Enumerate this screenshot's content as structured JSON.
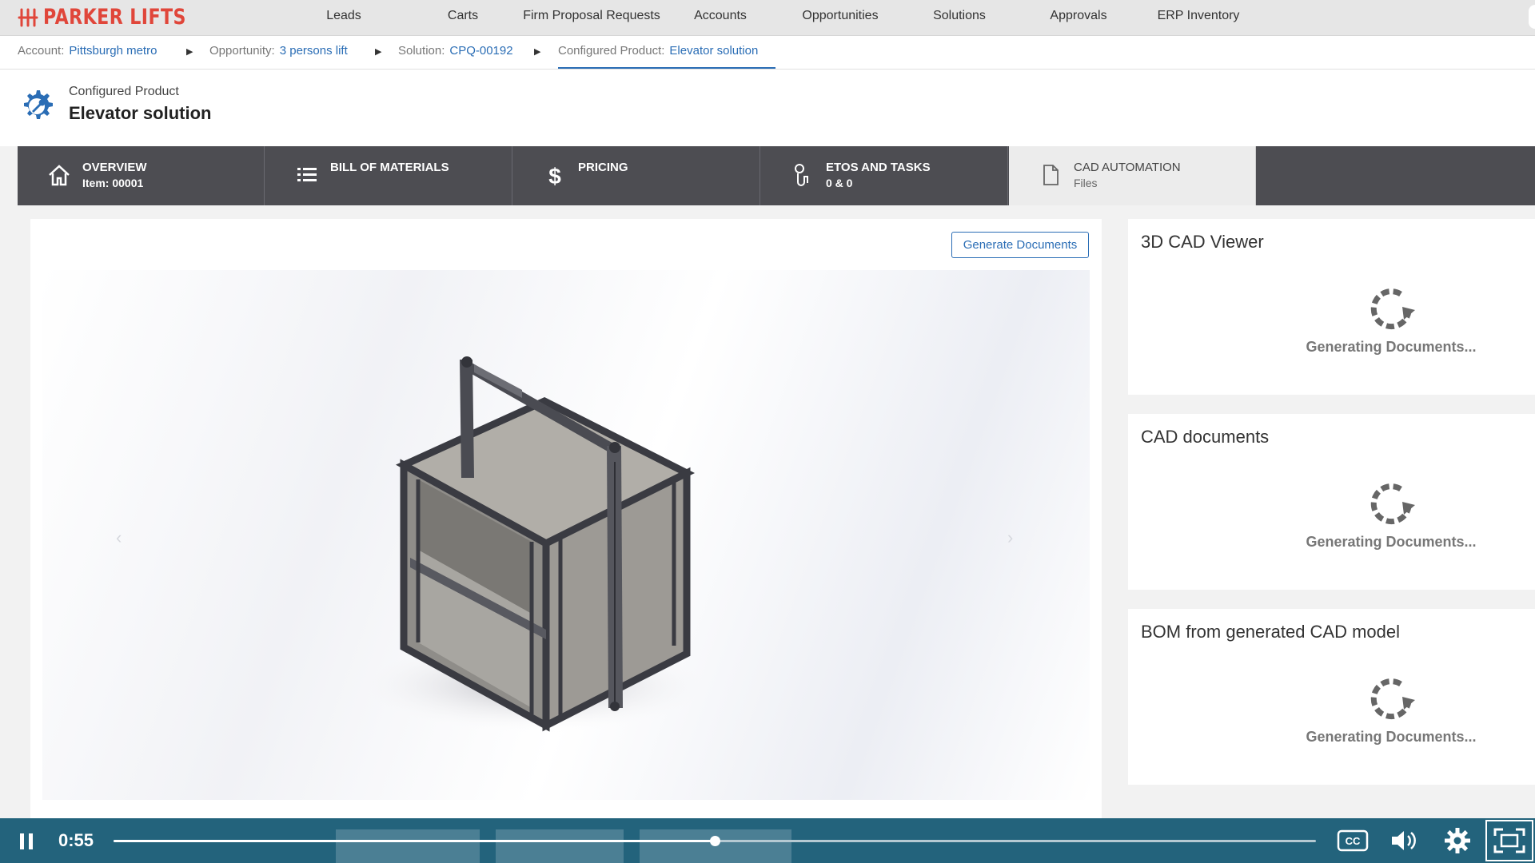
{
  "app": {
    "brand": "PARKER LIFTS",
    "brand_color": "#e0463a",
    "accent_color": "#2a6db5"
  },
  "nav": {
    "items": [
      {
        "label": "Leads"
      },
      {
        "label": "Carts"
      },
      {
        "label": "Firm Proposal Requests"
      },
      {
        "label": "Accounts"
      },
      {
        "label": "Opportunities"
      },
      {
        "label": "Solutions"
      },
      {
        "label": "Approvals"
      },
      {
        "label": "ERP Inventory"
      }
    ]
  },
  "breadcrumb": {
    "account": {
      "label": "Account:",
      "value": "Pittsburgh metro"
    },
    "opportunity": {
      "label": "Opportunity:",
      "value": "3 persons lift"
    },
    "solution": {
      "label": "Solution:",
      "value": "CPQ-00192"
    },
    "configured_product": {
      "label": "Configured Product:",
      "value": "Elevator solution"
    },
    "separator": "▶"
  },
  "header": {
    "subtitle": "Configured Product",
    "title": "Elevator solution",
    "icon": "gear-wrench-icon"
  },
  "tabs": [
    {
      "title": "OVERVIEW",
      "sub": "Item: 00001",
      "icon": "home-icon",
      "active": false
    },
    {
      "title": "BILL OF MATERIALS",
      "sub": "",
      "icon": "list-icon",
      "active": false
    },
    {
      "title": "PRICING",
      "sub": "",
      "icon": "dollar-icon",
      "active": false
    },
    {
      "title": "ETOS AND TASKS",
      "sub": "0 & 0",
      "icon": "tasks-icon",
      "active": false
    },
    {
      "title": "CAD AUTOMATION",
      "sub": "Files",
      "icon": "document-icon",
      "active": true
    }
  ],
  "main": {
    "generate_button": "Generate Documents",
    "prev_arrow": "‹",
    "next_arrow": "›",
    "model_image": "elevator-cabin-3d-model"
  },
  "panels": [
    {
      "title": "3D CAD Viewer",
      "status": "Generating Documents..."
    },
    {
      "title": "CAD documents",
      "status": "Generating Documents..."
    },
    {
      "title": "BOM from generated CAD model",
      "status": "Generating Documents..."
    }
  ],
  "video": {
    "time": "0:55",
    "progress": 0.5,
    "bar_color": "#23637c"
  }
}
